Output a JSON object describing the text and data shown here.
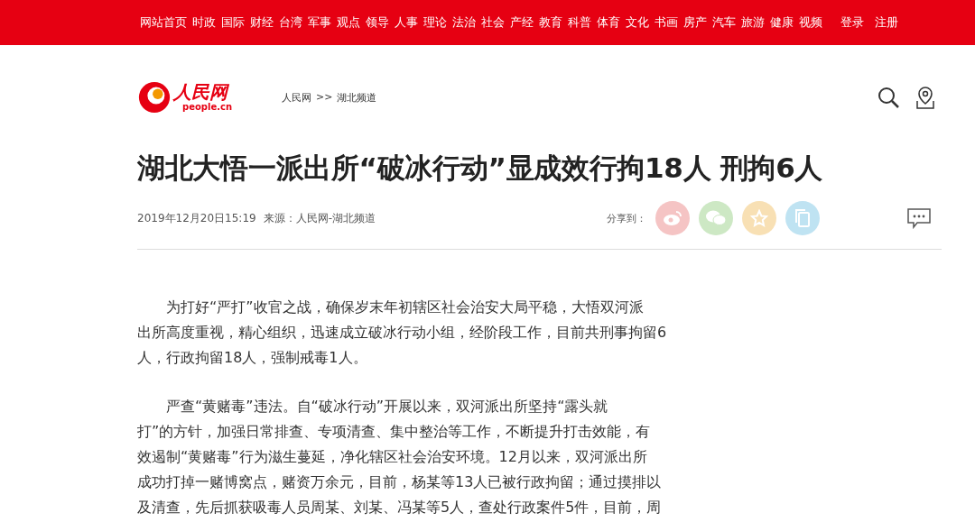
{
  "top_nav": {
    "links": [
      "网站首页",
      "时政",
      "国际",
      "财经",
      "台湾",
      "军事",
      "观点",
      "领导",
      "人事",
      "理论",
      "法治",
      "社会",
      "产经",
      "教育",
      "科普",
      "体育",
      "文化",
      "书画",
      "房产",
      "汽车",
      "旅游",
      "健康",
      "视频"
    ],
    "account": [
      "登录",
      "注册"
    ]
  },
  "header": {
    "logo_text": "人民网",
    "logo_domain": "people.cn",
    "breadcrumb": [
      "人民网",
      ">>",
      "湖北频道"
    ]
  },
  "article": {
    "title": "湖北大悟一派出所“破冰行动”显成效行拘18人 刑拘6人",
    "date": "2019年12月20日15:19",
    "source": "来源：人民网-湖北频道",
    "share_label": "分享到：",
    "share_buttons": [
      {
        "kind": "weibo",
        "color": "#f5c4c4"
      },
      {
        "kind": "wechat",
        "color": "#cde8c4"
      },
      {
        "kind": "favorite",
        "color": "#f8e0b4"
      },
      {
        "kind": "copy",
        "color": "#bfe3f2"
      }
    ],
    "paragraphs": [
      {
        "lines": [
          "为打好“严打”收官之战，确保岁末年初辖区社会治安大局平稳，大悟双河派",
          "出所高度重视，精心组织，迅速成立破冰行动小组，经阶段工作，目前共刑事拘留6",
          "人，行政拘留18人，强制戒毒1人。"
        ]
      },
      {
        "lines": [
          "严查“黄赌毒”违法。自“破冰行动”开展以来，双河派出所坚持“露头就",
          "打”的方针，加强日常排查、专项清查、集中整治等工作，不断提升打击效能，有",
          "效遏制“黄赌毒”行为滋生蔓延，净化辖区社会治安环境。12月以来，双河派出所",
          "成功打掉一赌博窝点，赌资万余元，目前，杨某等13人已被行政拘留；通过摸排以",
          "及清查，先后抓获吸毒人员周某、刘某、冯某等5人，查处行政案件5件，目前，周"
        ]
      }
    ]
  }
}
